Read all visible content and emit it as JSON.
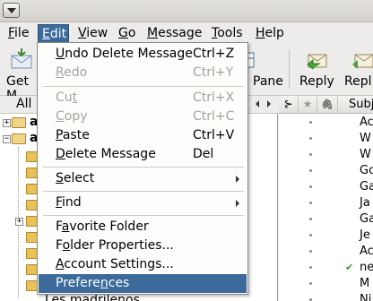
{
  "menubar": {
    "items": [
      {
        "label": "File",
        "mnemonic": "F",
        "rest": "ile"
      },
      {
        "label": "Edit",
        "mnemonic": "E",
        "rest": "dit"
      },
      {
        "label": "View",
        "mnemonic": "V",
        "rest": "iew"
      },
      {
        "label": "Go",
        "mnemonic": "G",
        "rest": "o"
      },
      {
        "label": "Message",
        "mnemonic": "M",
        "rest": "essage"
      },
      {
        "label": "Tools",
        "mnemonic": "T",
        "rest": "ools"
      },
      {
        "label": "Help",
        "mnemonic": "H",
        "rest": "elp"
      }
    ]
  },
  "toolbar": {
    "get_mail_label": "Get M",
    "pane_label": "Pane",
    "reply_label": "Reply",
    "reply_all_label": "Repl"
  },
  "folder_pane": {
    "header_label": "All",
    "rows": [
      {
        "label": "a"
      },
      {
        "label": "a"
      }
    ],
    "bottom_folder_label": "Les madrilenos"
  },
  "message_pane": {
    "columns": {
      "thread": "⊱",
      "star": "★",
      "attachment": "🖇",
      "subject": "Subj"
    },
    "subjects": [
      "Ac",
      "W",
      "W",
      "Go",
      "Ga",
      "Ja",
      "Ga",
      "Je",
      "Ac",
      "ne",
      "M",
      "Ni"
    ]
  },
  "edit_menu": {
    "items": [
      {
        "pre": "",
        "mn": "U",
        "post": "ndo Delete Message",
        "accel": "Ctrl+Z",
        "disabled": false
      },
      {
        "pre": "",
        "mn": "R",
        "post": "edo",
        "accel": "Ctrl+Y",
        "disabled": true
      },
      {
        "pre": "Cu",
        "mn": "t",
        "post": "",
        "accel": "Ctrl+X",
        "disabled": true
      },
      {
        "pre": "",
        "mn": "C",
        "post": "opy",
        "accel": "Ctrl+C",
        "disabled": true
      },
      {
        "pre": "",
        "mn": "P",
        "post": "aste",
        "accel": "Ctrl+V",
        "disabled": false
      },
      {
        "pre": "",
        "mn": "D",
        "post": "elete Message",
        "accel": "Del",
        "disabled": false
      },
      {
        "pre": "",
        "mn": "S",
        "post": "elect",
        "accel": "",
        "disabled": false,
        "submenu": true
      },
      {
        "pre": "",
        "mn": "F",
        "post": "ind",
        "accel": "",
        "disabled": false,
        "submenu": true
      },
      {
        "pre": "F",
        "mn": "a",
        "post": "vorite Folder",
        "accel": "",
        "disabled": false
      },
      {
        "pre": "F",
        "mn": "o",
        "post": "lder Properties...",
        "accel": "",
        "disabled": false
      },
      {
        "pre": "",
        "mn": "A",
        "post": "ccount Settings...",
        "accel": "",
        "disabled": false
      },
      {
        "pre": "Prefere",
        "mn": "n",
        "post": "ces",
        "accel": "",
        "disabled": false,
        "selected": true
      }
    ]
  },
  "colors": {
    "selection": "#3b6a9b",
    "menu_bg": "#fdfdfc",
    "disabled_text": "#a6a29c"
  }
}
